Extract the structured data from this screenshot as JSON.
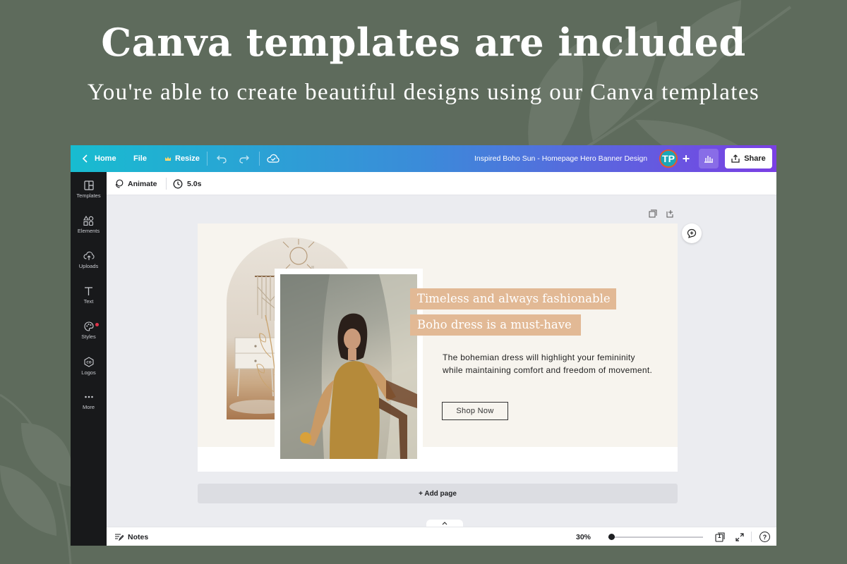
{
  "promo": {
    "title": "Canva templates are included",
    "subtitle": "You're able to create beautiful designs using our Canva templates"
  },
  "topbar": {
    "home_label": "Home",
    "file_label": "File",
    "resize_label": "Resize",
    "doc_title": "Inspired Boho Sun - Homepage Hero Banner Design",
    "avatar_initials": "TP",
    "add_label": "+",
    "share_label": "Share",
    "gradient": [
      "#18bcd0",
      "#3b8bd9",
      "#7b3fe4"
    ]
  },
  "sidebar": {
    "items": [
      {
        "label": "Templates",
        "icon": "templates-icon"
      },
      {
        "label": "Elements",
        "icon": "elements-icon"
      },
      {
        "label": "Uploads",
        "icon": "uploads-icon"
      },
      {
        "label": "Text",
        "icon": "text-icon"
      },
      {
        "label": "Styles",
        "icon": "styles-icon"
      },
      {
        "label": "Logos",
        "icon": "logos-icon"
      },
      {
        "label": "More",
        "icon": "more-icon"
      }
    ]
  },
  "toolbar": {
    "animate_label": "Animate",
    "duration_label": "5.0s"
  },
  "design": {
    "headline_1": "Timeless and always fashionable",
    "headline_2": "Boho dress is a must-have",
    "body": "The bohemian dress will highlight your femininity while maintaining comfort and freedom of movement.",
    "button_label": "Shop Now",
    "accent_color": "#e2b995",
    "background_color": "#f7f4ee"
  },
  "workspace": {
    "add_page_label": "+ Add page"
  },
  "bottombar": {
    "notes_label": "Notes",
    "zoom_label": "30%",
    "zoom_fraction": 0.3,
    "page_count": "1",
    "help_label": "?"
  }
}
